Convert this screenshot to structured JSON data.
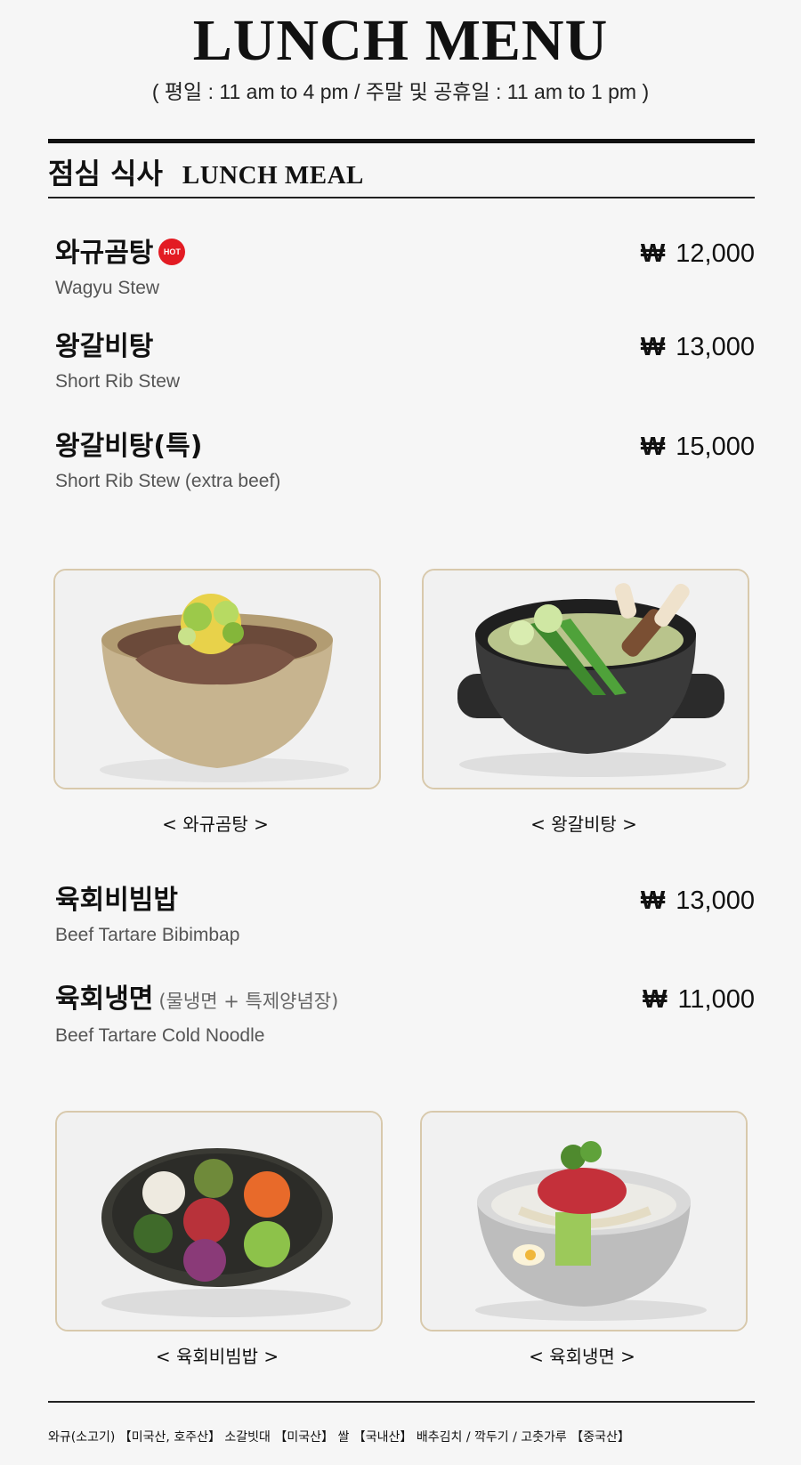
{
  "header": {
    "title": "LUNCH MENU",
    "hours": "( 평일 : 11 am to 4 pm / 주말 및 공휴일 : 11 am to 1 pm )"
  },
  "section": {
    "title_ko": "점심 식사",
    "title_en": "LUNCH MEAL"
  },
  "currency": "₩",
  "hot_badge": "HOT",
  "items": [
    {
      "name_ko": "와규곰탕",
      "name_en": "Wagyu Stew",
      "price": "12,000",
      "hot": true
    },
    {
      "name_ko": "왕갈비탕",
      "name_en": "Short Rib Stew",
      "price": "13,000"
    },
    {
      "name_ko": "왕갈비탕(특)",
      "name_en": "Short Rib Stew (extra beef)",
      "price": "15,000"
    },
    {
      "name_ko": "육회비빔밥",
      "name_en": "Beef Tartare Bibimbap",
      "price": "13,000"
    },
    {
      "name_ko": "육회냉면",
      "note": "(물냉면 + 특제양념장)",
      "name_en": "Beef Tartare Cold Noodle",
      "price": "11,000"
    }
  ],
  "photos": [
    {
      "caption": "< 와규곰탕 >"
    },
    {
      "caption": "< 왕갈비탕 >"
    },
    {
      "caption": "< 육회비빔밥 >"
    },
    {
      "caption": "< 육회냉면 >"
    }
  ],
  "footer": {
    "origin": "와규(소고기) 【미국산, 호주산】   소갈빗대 【미국산】   쌀 【국내산】   배추김치 / 깍두기 / 고춧가루 【중국산】"
  }
}
